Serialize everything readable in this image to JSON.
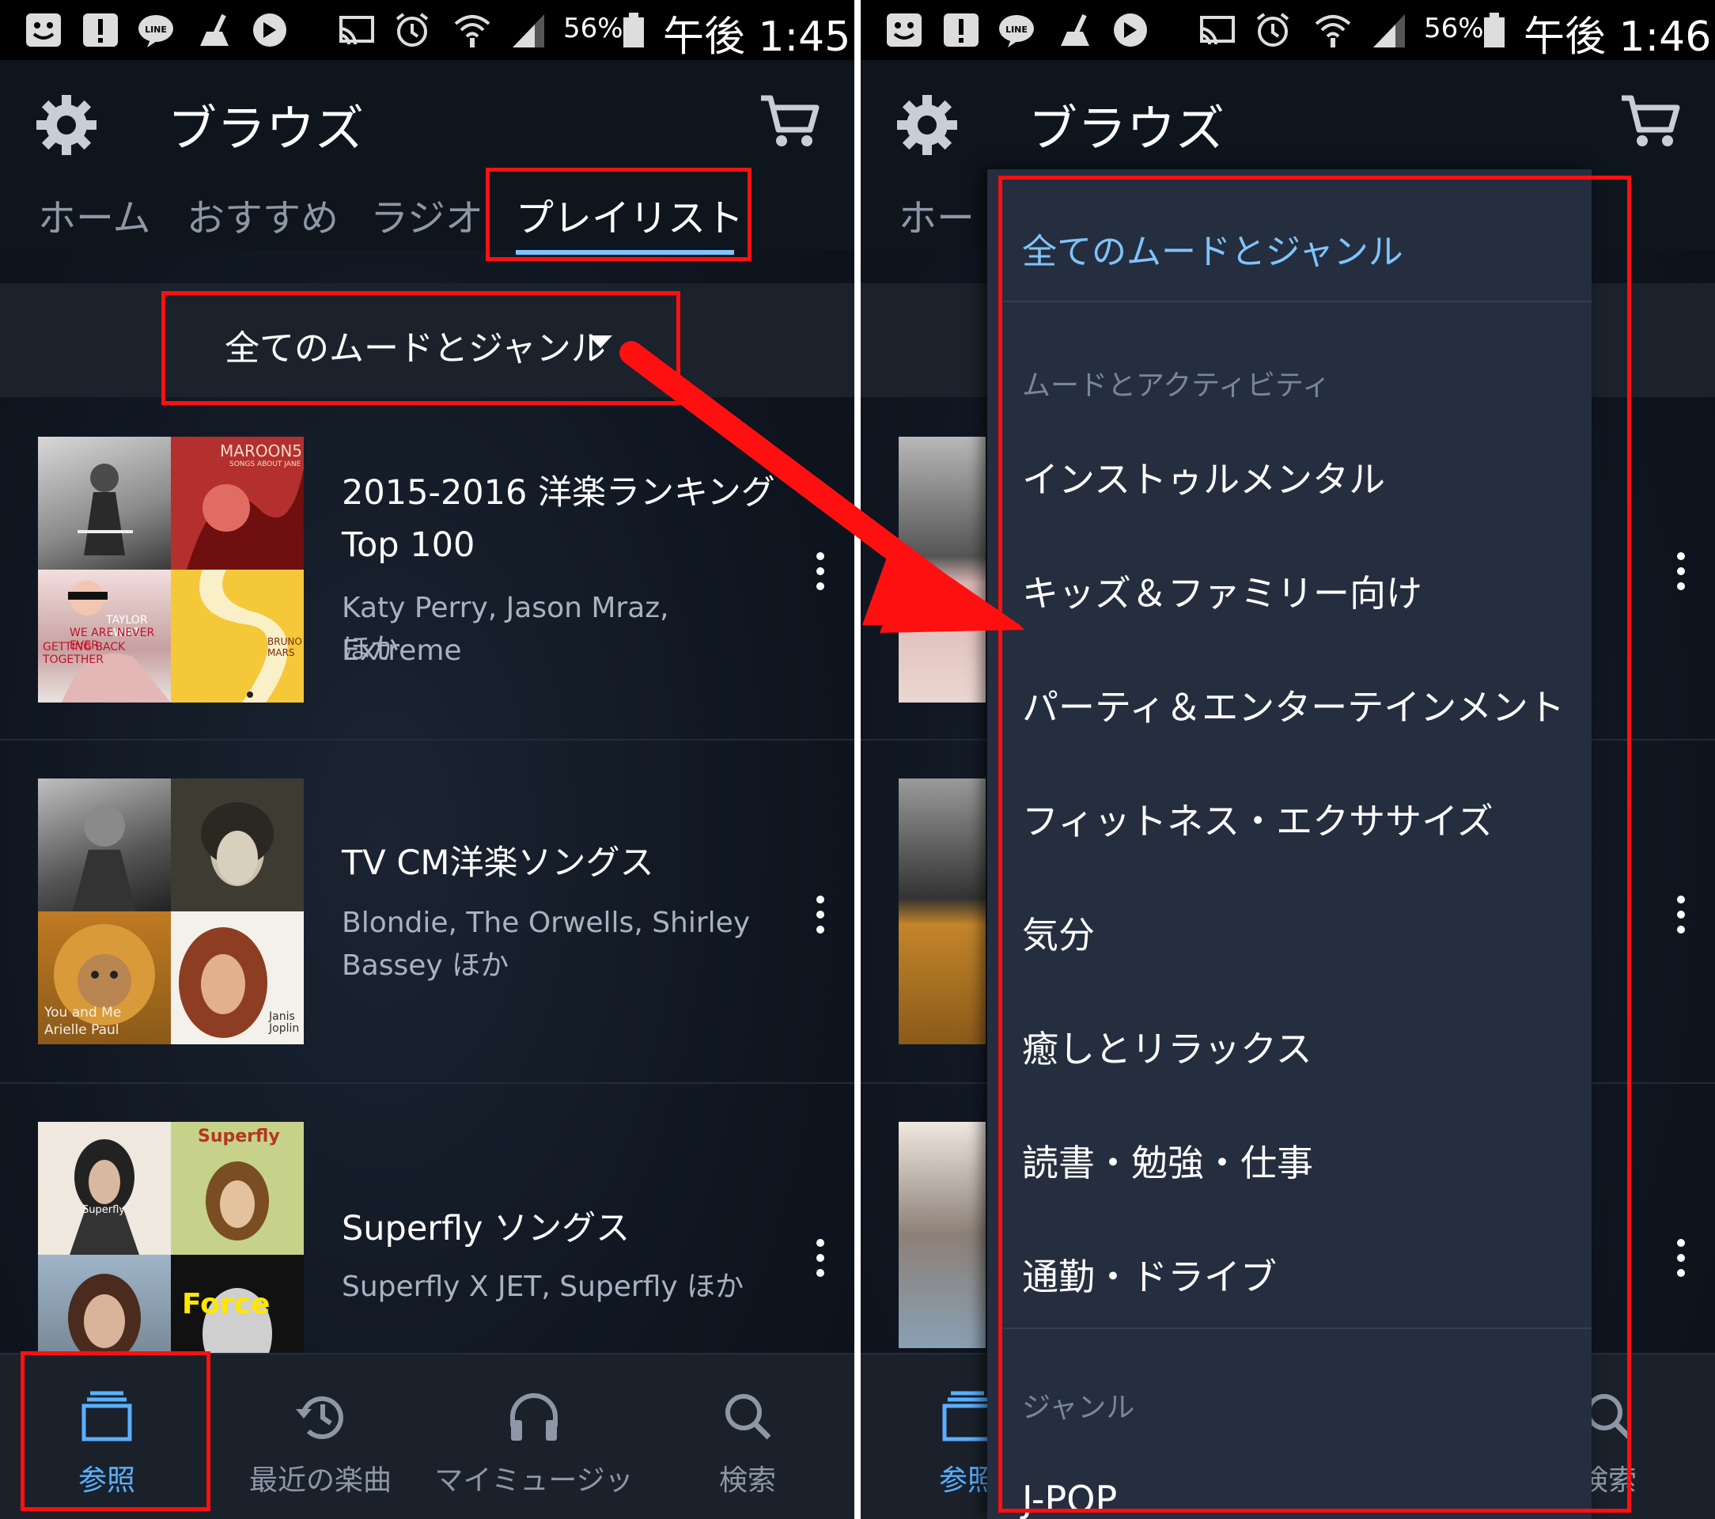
{
  "status_left": {
    "battery": "56%",
    "time": "午後 1:45"
  },
  "status_right": {
    "battery": "56%",
    "time": "午後 1:46"
  },
  "status_icons": [
    "emoji-icon",
    "alert-icon",
    "line-icon",
    "broom-icon",
    "app-icon",
    "cast-icon",
    "alarm-icon",
    "wifi-icon",
    "signal-icon",
    "battery-icon"
  ],
  "header": {
    "title": "ブラウズ"
  },
  "tabs": [
    {
      "label": "ホーム"
    },
    {
      "label": "おすすめ"
    },
    {
      "label": "ラジオ"
    },
    {
      "label": "プレイリスト",
      "active": true
    }
  ],
  "filter": {
    "label": "全てのムードとジャンル"
  },
  "playlists": [
    {
      "title_line1": "2015-2016 洋楽ランキング",
      "title_line2": "Top 100",
      "artists_line1": "Katy Perry, Jason Mraz, Extreme",
      "artists_line2": "ほか",
      "art_texts": [
        "MAROON5",
        "SONGS ABOUT JANE",
        "TAYLOR SWIFT",
        "WE ARE NEVER EVER",
        "GETTING BACK TOGETHER",
        "BRUNO MARS"
      ]
    },
    {
      "title_line1": "TV CM洋楽ソングス",
      "title_line2": "",
      "artists_line1": "Blondie, The Orwells, Shirley",
      "artists_line2": "Bassey ほか",
      "art_texts": [
        "You and Me",
        "Arielle Paul",
        "Janis Joplin"
      ]
    },
    {
      "title_line1": "Superfly ソングス",
      "title_line2": "",
      "artists_line1": "Superfly X JET, Superfly ほか",
      "artists_line2": "",
      "art_texts": [
        "Superfly",
        "Superfly",
        "Force"
      ]
    }
  ],
  "bottom_nav": [
    {
      "label": "参照",
      "icon": "browse-icon",
      "active": true
    },
    {
      "label": "最近の楽曲",
      "icon": "history-icon"
    },
    {
      "label": "マイミュージッ",
      "icon": "headphones-icon"
    },
    {
      "label": "検索",
      "icon": "search-icon"
    }
  ],
  "right_peek": {
    "tab": "ホー",
    "nav_browse": "参照",
    "nav_search": "検索"
  },
  "dropdown": {
    "selected": "全てのムードとジャンル",
    "section_mood": "ムードとアクティビティ",
    "mood_items": [
      "インストゥルメンタル",
      "キッズ＆ファミリー向け",
      "パーティ＆エンターテインメント",
      "フィットネス・エクササイズ",
      "気分",
      "癒しとリラックス",
      "読書・勉強・仕事",
      "通勤・ドライブ"
    ],
    "section_genre": "ジャンル",
    "genre_items": [
      "J-POP"
    ]
  },
  "colors": {
    "accent": "#5ab0ff",
    "annotation": "#ff1010",
    "background": "#101722"
  }
}
